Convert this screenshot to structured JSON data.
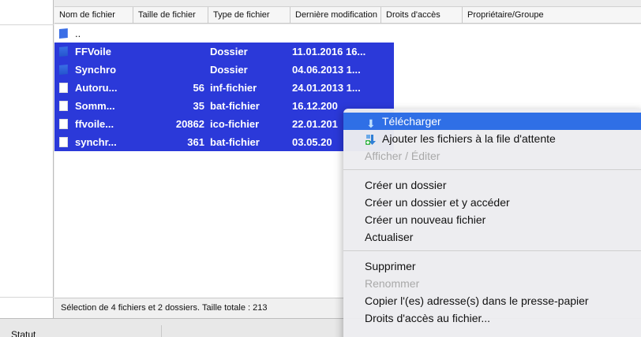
{
  "columns": [
    {
      "label": "Nom de fichier",
      "w": 100
    },
    {
      "label": "Taille de fichier",
      "w": 95
    },
    {
      "label": "Type de fichier",
      "w": 104
    },
    {
      "label": "Dernière modification",
      "w": 115
    },
    {
      "label": "Droits d'accès",
      "w": 103
    },
    {
      "label": "Propriétaire/Groupe",
      "w": 226
    }
  ],
  "files": [
    {
      "name": "..",
      "size": "",
      "type": "",
      "modified": "",
      "selected": false,
      "kind": "up"
    },
    {
      "name": "FFVoile",
      "size": "",
      "type": "Dossier",
      "modified": "11.01.2016 16...",
      "selected": true,
      "kind": "folder"
    },
    {
      "name": "Synchro",
      "size": "",
      "type": "Dossier",
      "modified": "04.06.2013 1...",
      "selected": true,
      "kind": "folder"
    },
    {
      "name": "Autoru...",
      "size": "56",
      "type": "inf-fichier",
      "modified": "24.01.2013 1...",
      "selected": true,
      "kind": "file"
    },
    {
      "name": "Somm...",
      "size": "35",
      "type": "bat-fichier",
      "modified": "16.12.200",
      "selected": true,
      "kind": "file"
    },
    {
      "name": "ffvoile...",
      "size": "20862",
      "type": "ico-fichier",
      "modified": "22.01.201",
      "selected": true,
      "kind": "file"
    },
    {
      "name": "synchr...",
      "size": "361",
      "type": "bat-fichier",
      "modified": "03.05.20",
      "selected": true,
      "kind": "file"
    }
  ],
  "status_text": "Sélection de 4 fichiers et 2 dossiers. Taille totale : 213",
  "bottom_tab": "Statut",
  "menu": {
    "download": "Télécharger",
    "add_queue": "Ajouter les fichiers à la file d'attente",
    "view_edit": "Afficher / Éditer",
    "create_dir": "Créer un dossier",
    "create_dir_enter": "Créer un dossier et y accéder",
    "create_file": "Créer un nouveau fichier",
    "refresh": "Actualiser",
    "delete": "Supprimer",
    "rename": "Renommer",
    "copy_url": "Copier l'(es) adresse(s) dans le presse-papier",
    "permissions": "Droits d'accès au fichier..."
  },
  "colors": {
    "selection": "#2b39d9",
    "menu_highlight": "#2f6fe6"
  },
  "icons": {
    "folder": "folder-icon",
    "file": "file-icon",
    "download": "download-arrow-icon",
    "queue": "queue-add-icon"
  }
}
